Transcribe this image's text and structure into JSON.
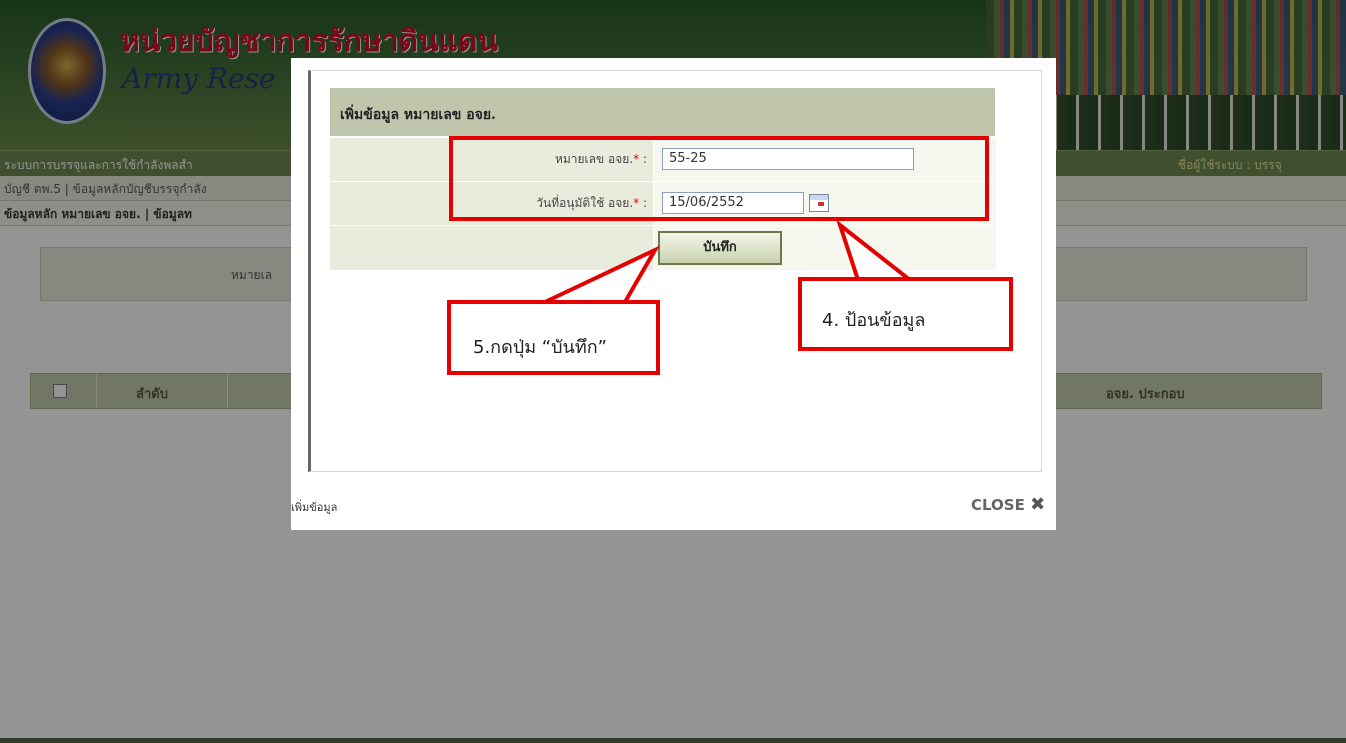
{
  "header": {
    "title_th": "หน่วยบัญชาการรักษาดินแดน",
    "title_en": "Army Rese"
  },
  "nav": {
    "system_name": "ระบบการบรรจุและการใช้กำลังพลสำ",
    "user_label": "ชื่อผู้ใช้ระบบ : บรรจุ",
    "breadcrumb": "บัญชี ตพ.5 | ข้อมูลหลักบัญชีบรรจุกำลัง",
    "submenu": "ข้อมูลหลัก หมายเลข อจย. | ข้อมูลท"
  },
  "search": {
    "label": "หมายเล"
  },
  "table": {
    "col_order": "ลำดับ",
    "col_components": "อจย. ประกอบ"
  },
  "modal": {
    "form_title": "เพิ่มข้อมูล หมายเลข อจย.",
    "fields": [
      {
        "label": "หมายเลข อจย.",
        "required_mark": "*",
        "colon": ":",
        "value": "55-25"
      },
      {
        "label": "วันที่อนุมัติใช้ อจย.",
        "required_mark": "*",
        "colon": ":",
        "value": "15/06/2552"
      }
    ],
    "save_label": "บันทึก",
    "footer_title": "เพิ่มข้อมูล",
    "close_label": "CLOSE",
    "close_icon": "close-x-icon"
  },
  "annotations": {
    "step4": "4. ป้อนข้อมูล",
    "step5": "5.กดปุ่ม “บันทึก”",
    "color": "#e50000"
  }
}
